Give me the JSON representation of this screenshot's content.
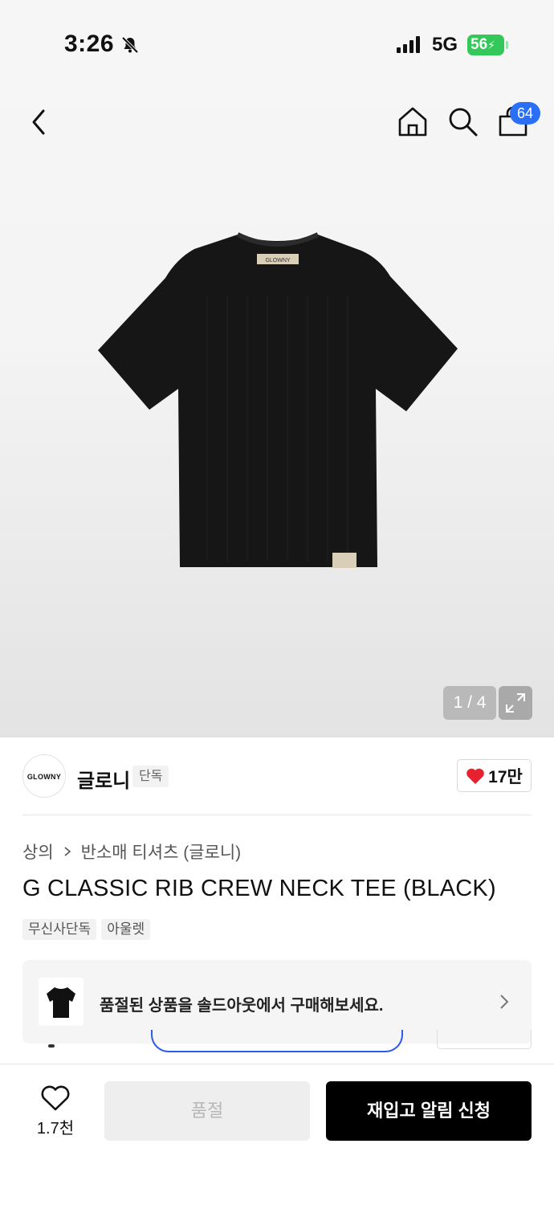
{
  "status_bar": {
    "time": "3:26",
    "network": "5G",
    "battery": "56"
  },
  "nav": {
    "cart_badge": "64",
    "icons": [
      "back-icon",
      "home-icon",
      "search-icon",
      "cart-icon"
    ]
  },
  "gallery": {
    "counter": "1 / 4",
    "label_text": "GLOWNY"
  },
  "brand": {
    "logo_text": "GLOWNY",
    "name": "글로니",
    "tag": "단독",
    "likes": "17만"
  },
  "breadcrumb": {
    "category": "상의",
    "subcategory": "반소매 티셔츠 (글로니)"
  },
  "product": {
    "title": "G CLASSIC RIB CREW NECK TEE (BLACK)",
    "tags": [
      "무신사단독",
      "아울렛"
    ]
  },
  "soldout_banner": {
    "text": "품절된 상품을 솔드아웃에서 구매해보세요."
  },
  "bottom_bar": {
    "wish_count": "1.7천",
    "soldout_label": "품절",
    "restock_label": "재입고 알림 신청"
  },
  "colors": {
    "accent": "#2b6ff6",
    "battery": "#34c759",
    "heart": "#e8212f"
  }
}
